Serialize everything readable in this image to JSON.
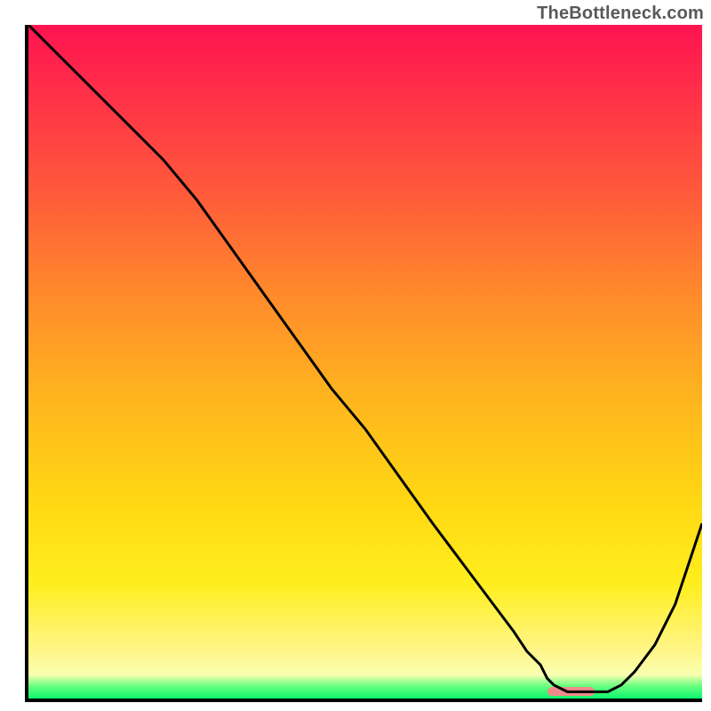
{
  "watermark": "TheBottleneck.com",
  "colors": {
    "gradient_top": "#ff1351",
    "gradient_mid": "#ffd613",
    "gradient_bottom": "#0df56f",
    "axis": "#000000",
    "curve": "#000000",
    "marker": "#f08a8a"
  },
  "chart_data": {
    "type": "line",
    "title": "",
    "xlabel": "",
    "ylabel": "",
    "xlim": [
      0,
      100
    ],
    "ylim": [
      0,
      100
    ],
    "grid": false,
    "legend": false,
    "x": [
      0,
      5,
      10,
      15,
      20,
      25,
      30,
      35,
      40,
      45,
      50,
      55,
      60,
      63,
      66,
      69,
      72,
      74,
      76,
      77,
      78,
      80,
      82,
      84,
      86,
      88,
      90,
      93,
      96,
      100
    ],
    "values": [
      100,
      95,
      90,
      85,
      80,
      74,
      67,
      60,
      53,
      46,
      40,
      33,
      26,
      22,
      18,
      14,
      10,
      7,
      5,
      3,
      2,
      1,
      1,
      1,
      1,
      2,
      4,
      8,
      14,
      26
    ],
    "optimum_range": {
      "x_start": 77,
      "x_end": 84,
      "y": 1
    },
    "annotations": []
  }
}
